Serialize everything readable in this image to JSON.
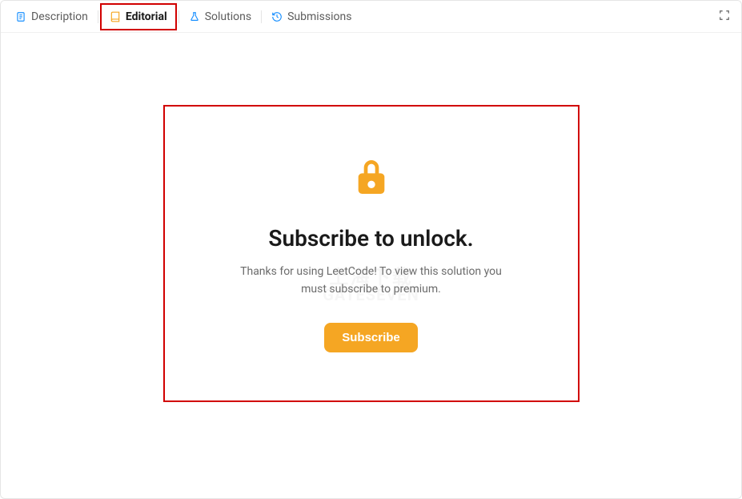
{
  "tabs": {
    "description": "Description",
    "editorial": "Editorial",
    "solutions": "Solutions",
    "submissions": "Submissions"
  },
  "lock_panel": {
    "title": "Subscribe to unlock.",
    "subtitle": "Thanks for using LeetCode! To view this solution you must subscribe to premium.",
    "button_label": "Subscribe"
  },
  "watermark": {
    "line1": "上海下载",
    "line2": "GATESEVEN"
  }
}
